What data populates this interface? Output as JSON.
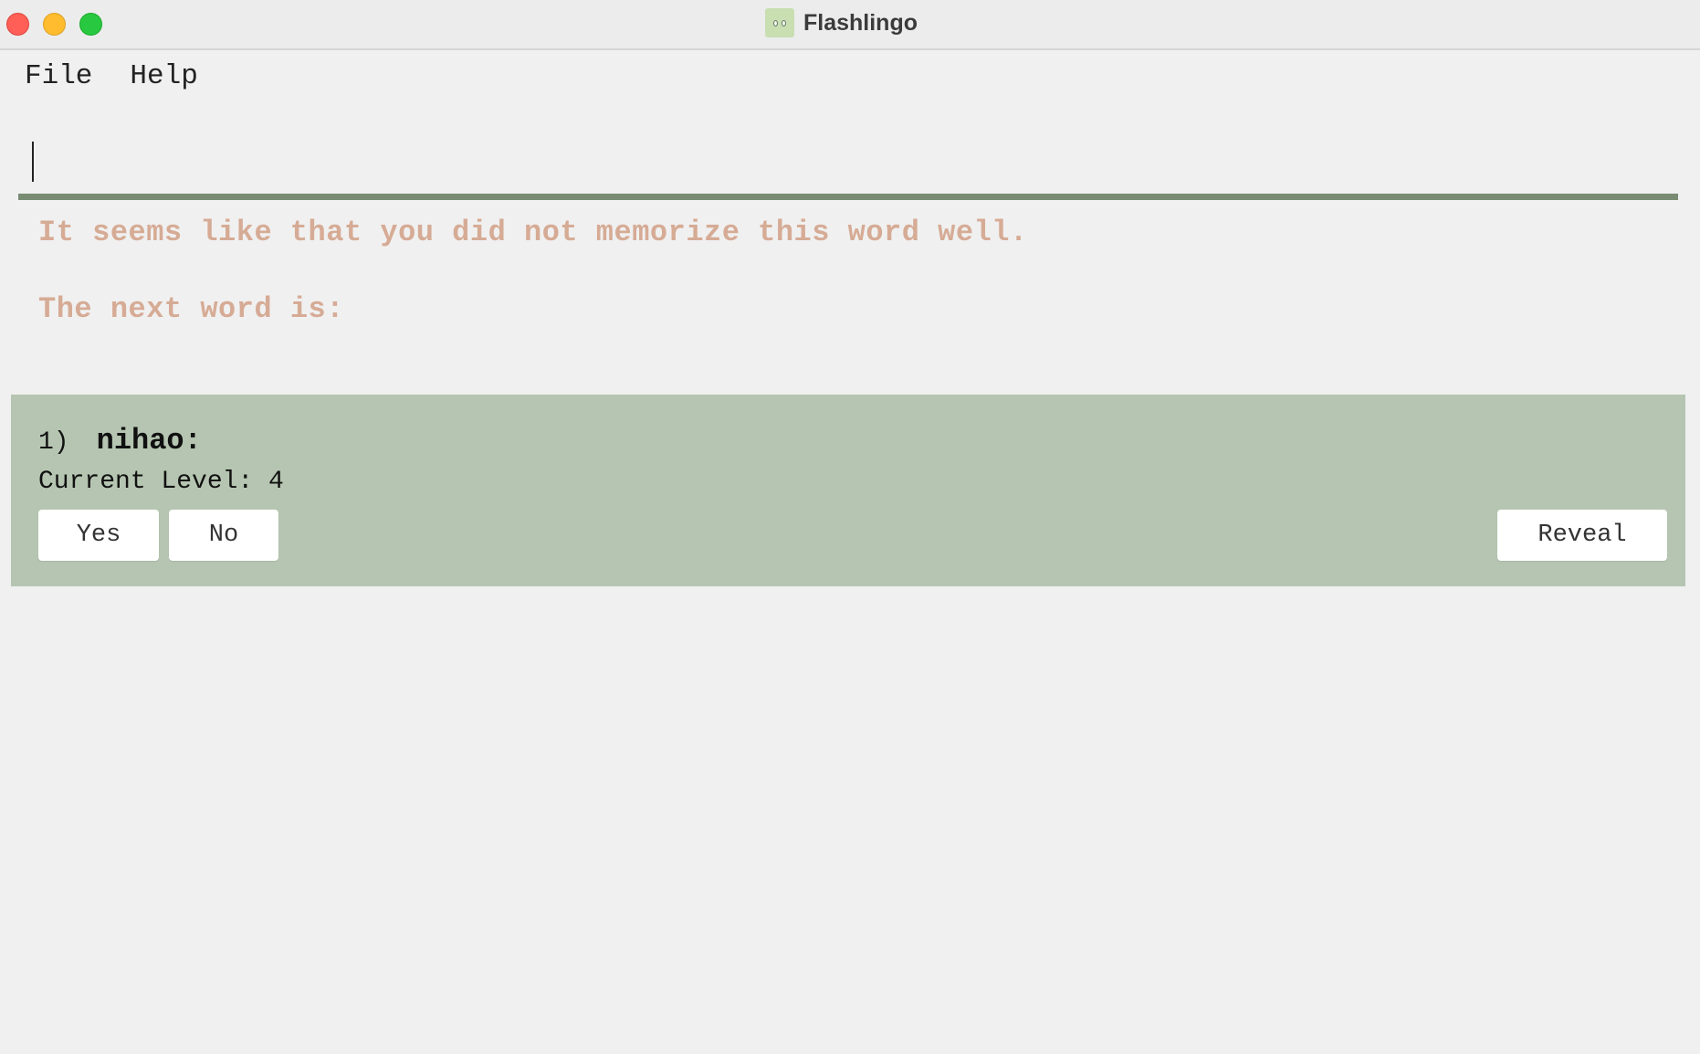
{
  "window": {
    "title": "Flashlingo",
    "icon": "owl-app-icon"
  },
  "menu": {
    "items": [
      "File",
      "Help"
    ]
  },
  "command": {
    "value": "",
    "placeholder": ""
  },
  "result": {
    "line1": "It seems like that you did not memorize this word well.",
    "line2": "The next word is:"
  },
  "card": {
    "index": "1)",
    "word": "nihao:",
    "level_text": "Current Level: 4",
    "buttons": {
      "yes": "Yes",
      "no": "No",
      "reveal": "Reveal"
    }
  },
  "colors": {
    "accent": "#798c73",
    "card_bg": "#b5c5b1",
    "result_text": "#d6ab95",
    "window_bg": "#f0f0f0"
  }
}
